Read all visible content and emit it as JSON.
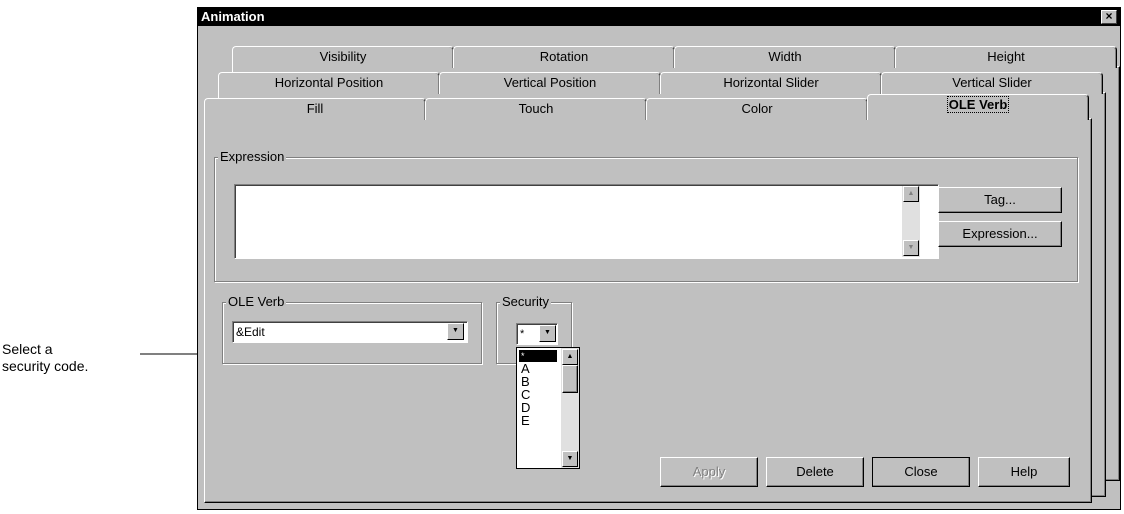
{
  "window": {
    "title": "Animation",
    "close_label": "×"
  },
  "tabs": {
    "row1": [
      "Visibility",
      "Rotation",
      "Width",
      "Height"
    ],
    "row2": [
      "Horizontal Position",
      "Vertical Position",
      "Horizontal Slider",
      "Vertical Slider"
    ],
    "row3": [
      "Fill",
      "Touch",
      "Color",
      "OLE Verb"
    ],
    "active": "OLE Verb"
  },
  "expression": {
    "group_label": "Expression",
    "value": "",
    "tag_button": "Tag...",
    "expression_button": "Expression..."
  },
  "ole_verb": {
    "group_label": "OLE Verb",
    "selected": "&Edit"
  },
  "security": {
    "group_label": "Security",
    "selected": "*",
    "options": [
      "*",
      "A",
      "B",
      "C",
      "D",
      "E"
    ],
    "highlighted": "*"
  },
  "footer": {
    "apply": "Apply",
    "delete": "Delete",
    "close": "Close",
    "help": "Help"
  },
  "annotation": {
    "line1": "Select a",
    "line2": "security code."
  }
}
